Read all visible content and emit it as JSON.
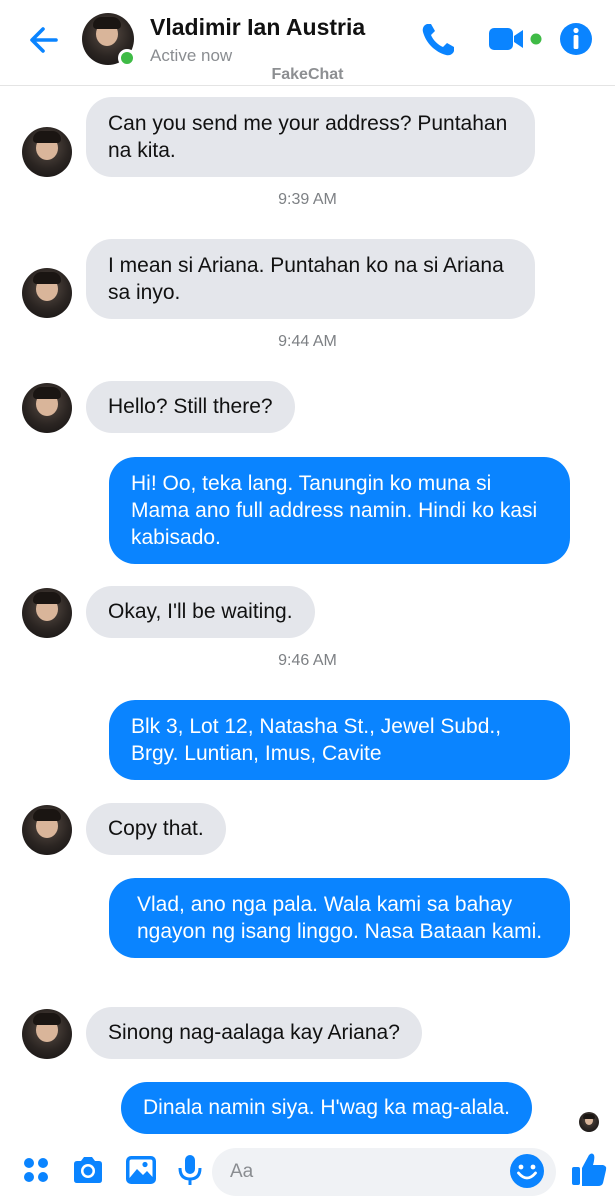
{
  "header": {
    "name": "Vladimir Ian Austria",
    "status": "Active now",
    "watermark": "FakeChat",
    "icons": [
      "back-arrow-icon",
      "phone-icon",
      "video-camera-icon",
      "info-icon"
    ],
    "accent": "#0a84ff",
    "online_color": "#3fbb46"
  },
  "messages": [
    {
      "from": "them",
      "text": "Can you send me your address? Puntahan na kita."
    },
    {
      "time": "9:39 AM"
    },
    {
      "from": "them",
      "text": "I mean si Ariana. Puntahan ko na si Ariana sa inyo."
    },
    {
      "time": "9:44 AM"
    },
    {
      "from": "them",
      "text": "Hello? Still there?"
    },
    {
      "from": "me",
      "text": "Hi! Oo, teka lang. Tanungin ko muna si Mama ano full address namin. Hindi ko kasi kabisado."
    },
    {
      "from": "them",
      "text": "Okay, I'll be waiting."
    },
    {
      "time": "9:46 AM"
    },
    {
      "from": "me",
      "text": "Blk 3, Lot 12, Natasha St., Jewel Subd., Brgy. Luntian, Imus, Cavite"
    },
    {
      "from": "them",
      "text": "Copy that."
    },
    {
      "from": "me",
      "text": "Vlad, ano nga pala. Wala kami sa bahay ngayon ng isang linggo. Nasa Bataan kami."
    },
    {
      "from": "them",
      "text": "Sinong nag-aalaga kay Ariana?"
    },
    {
      "from": "me",
      "text": "Dinala namin siya. H'wag ka mag-alala."
    }
  ],
  "composer": {
    "placeholder": "Aa",
    "icons": [
      "apps-icon",
      "camera-icon",
      "gallery-icon",
      "microphone-icon",
      "emoji-icon",
      "thumbs-up-icon"
    ]
  },
  "colors": {
    "incoming_bubble": "#e4e6eb",
    "outgoing_bubble": "#0a84ff"
  }
}
